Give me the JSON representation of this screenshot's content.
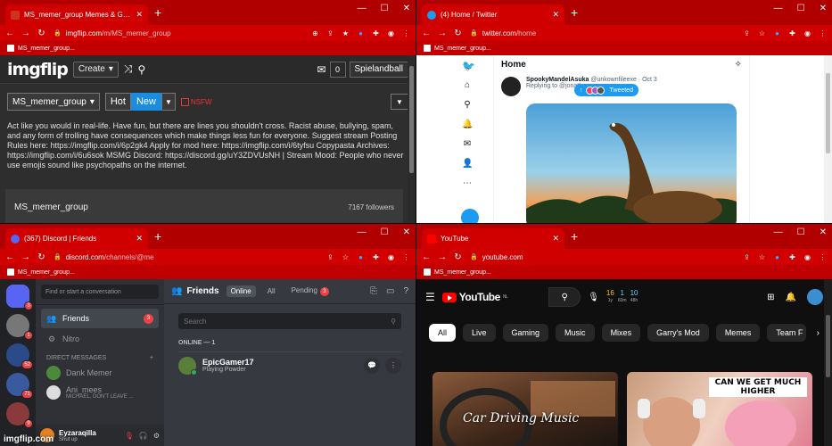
{
  "windows": {
    "tl": {
      "tab_title": "MS_memer_group Memes & GIFs",
      "url_host": "imgflip.com",
      "url_path": "/m/MS_memer_group",
      "bookmark": "MS_memer_group..."
    },
    "tr": {
      "tab_title": "(4) Home / Twitter",
      "url_host": "twitter.com",
      "url_path": "/home",
      "bookmark": "MS_memer_group..."
    },
    "bl": {
      "tab_title": "(367) Discord | Friends",
      "url_host": "discord.com",
      "url_path": "/channels/@me",
      "bookmark": "MS_memer_group..."
    },
    "br": {
      "tab_title": "YouTube",
      "url_host": "youtube.com",
      "url_path": "",
      "bookmark": "MS_memer_group..."
    }
  },
  "imgflip": {
    "logo": "imgflip",
    "create_label": "Create",
    "notif_count": "0",
    "username": "Spielandball",
    "stream_select": "MS_memer_group",
    "hot_label": "Hot",
    "new_label": "New",
    "nsfw_label": "NSFW",
    "description": "Act like you would in real-life. Have fun, but there are lines you shouldn't cross. Racist abuse, bullying, spam, and any form of trolling have consequences which make things less fun for everyone. Suggest stream Posting Rules here: https://imgflip.com/i/6p2gk4 Apply for mod here: https://imgflip.com/i/6tyfsu Copypasta Archives: https://imgflip.com/i/6u6sok MSMG Discord: https://discord.gg/uY3ZDVUsNH | Stream Mood: People who never use emojis sound like psychopaths on the internet.",
    "card_name": "MS_memer_group",
    "followers": "7167 followers"
  },
  "twitter": {
    "heading": "Home",
    "author": "SpookyMandelAsuka",
    "handle": "@unkownfileexe · Oct 3",
    "replying": "Replying to @jonath...",
    "tweeted_label": "Tweeted"
  },
  "discord": {
    "find_placeholder": "Find or start a conversation",
    "friends_label": "Friends",
    "friends_badge": "3",
    "nitro_label": "Nitro",
    "dm_header": "DIRECT MESSAGES",
    "dms": [
      {
        "name": "Dank Memer",
        "sub": ""
      },
      {
        "name": "Ani_mees",
        "sub": "MICHAEL, DON'T LEAVE ..."
      }
    ],
    "rail_badges": [
      "3",
      "1",
      "52",
      "71",
      "9"
    ],
    "user_name": "Eyzaraqilla",
    "user_status": "Shut up",
    "top_title": "Friends",
    "tab_online": "Online",
    "tab_all": "All",
    "tab_pending": "Pending",
    "pending_badge": "3",
    "search_placeholder": "Search",
    "online_header": "ONLINE — 1",
    "friend_name": "EpicGamer17",
    "friend_activity": "Playing Powder"
  },
  "youtube": {
    "logo_text": "YouTube",
    "region": "NL",
    "stats": [
      {
        "value": "16",
        "sub": "1y"
      },
      {
        "value": "1",
        "sub": "60m"
      },
      {
        "value": "10",
        "sub": "48h"
      }
    ],
    "chips": [
      "All",
      "Live",
      "Gaming",
      "Music",
      "Mixes",
      "Garry's Mod",
      "Memes",
      "Team F"
    ],
    "thumb1_text": "Car Driving Music",
    "thumb2_text": "CAN WE GET MUCH HIGHER"
  },
  "watermark": "imgflip.com",
  "colors": {
    "chrome_red": "#d10000",
    "imgflip_new": "#1a8de0",
    "twitter_blue": "#1d9bf0",
    "discord_red": "#ed4245",
    "youtube_red": "#ff0000"
  }
}
